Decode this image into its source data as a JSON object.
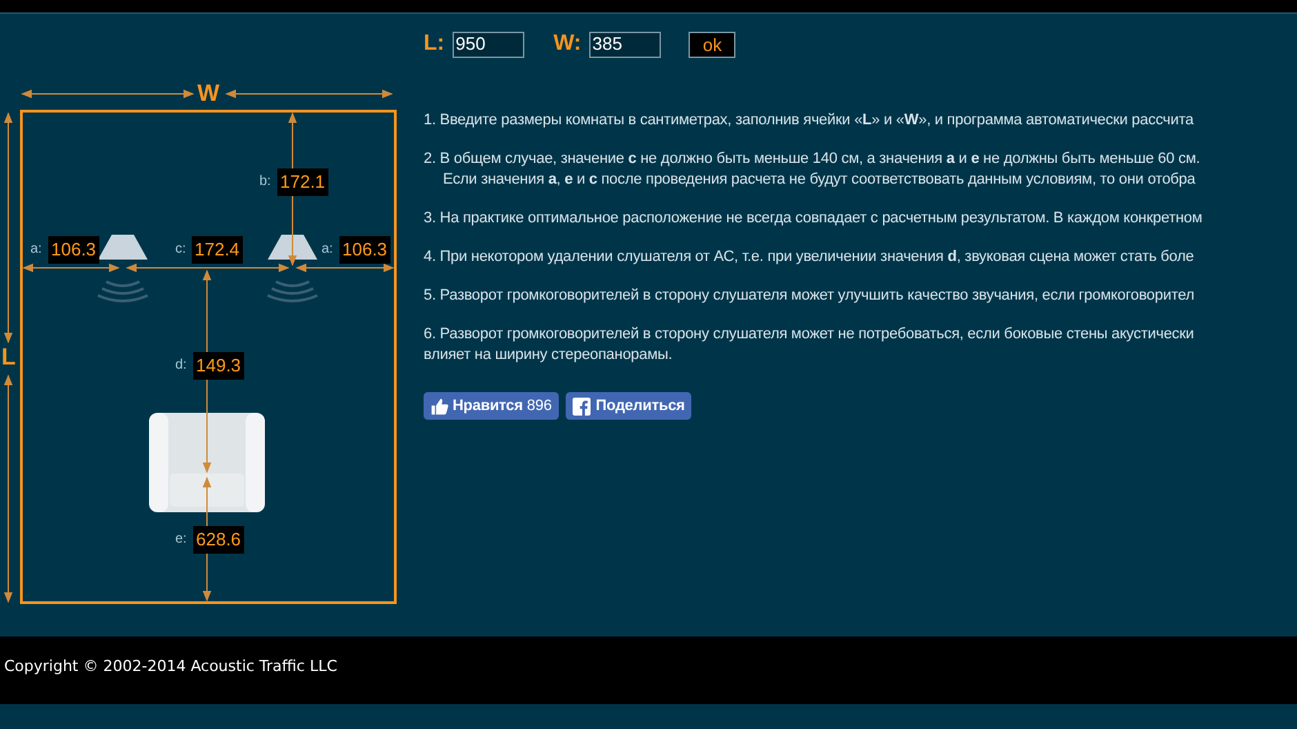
{
  "form": {
    "fields": [
      {
        "label": "L:",
        "value": "950"
      },
      {
        "label": "W:",
        "value": "385"
      }
    ],
    "button": "ok"
  },
  "diagram": {
    "width_label": "W",
    "length_label": "L",
    "measurements": [
      {
        "label": "b:",
        "value": "172.1"
      },
      {
        "label": "a:",
        "value": "106.3"
      },
      {
        "label": "c:",
        "value": "172.4"
      },
      {
        "label": "a:",
        "value": "106.3"
      },
      {
        "label": "d:",
        "value": "149.3"
      },
      {
        "label": "e:",
        "value": "628.6"
      }
    ]
  },
  "instructions": [
    {
      "lines": [
        "1. Введите размеры комнаты в сантиметрах, заполнив ячейки «**L**» и «**W**», и программа автоматически рассчита"
      ]
    },
    {
      "lines": [
        "2. В общем случае, значение **c** не должно быть меньше 140 см, а значения **a** и **e** не должны быть меньше 60 см.",
        "Если значения **a**, **e** и **c** после проведения расчета не будут соответствовать данным условиям, то они отобра"
      ]
    },
    {
      "lines": [
        "3. На практике оптимальное расположение не всегда совпадает с расчетным результатом. В каждом конкретном"
      ]
    },
    {
      "lines": [
        "4. При некотором удалении слушателя от АС, т.е. при увеличении значения **d**, звуковая сцена может стать боле"
      ]
    },
    {
      "lines": [
        "5. Разворот громкоговорителей в сторону слушателя может улучшить качество звучания, если громкоговорител"
      ]
    },
    {
      "lines": [
        "6. Разворот громкоговорителей в сторону слушателя может не потребоваться, если боковые стены акустически",
        "влияет на ширину стереопанорамы."
      ]
    }
  ],
  "social": {
    "like": {
      "label": "Нравится",
      "count": "896"
    },
    "share": "Поделиться"
  },
  "footer": "Copyright © 2002-2014 Acoustic Traffic LLC"
}
